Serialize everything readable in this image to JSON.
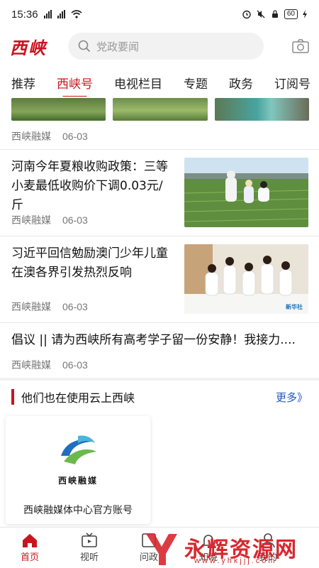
{
  "status_bar": {
    "time": "15:36",
    "battery": "60"
  },
  "header": {
    "logo": "西峡",
    "search_placeholder": "党政要闻"
  },
  "tabs": [
    "推荐",
    "西峡号",
    "电视栏目",
    "专题",
    "政务",
    "订阅号"
  ],
  "active_tab": "西峡号",
  "partial_item": {
    "source": "西峡融媒",
    "date": "06-03"
  },
  "news": [
    {
      "title_lines": [
        "河南今年夏粮收购政策：三等",
        "小麦最低收购价下调0.03元/",
        "斤"
      ],
      "source": "西峡融媒",
      "date": "06-03"
    },
    {
      "title_lines": [
        "习近平回信勉励澳门少年儿童",
        "在澳各界引发热烈反响"
      ],
      "source": "西峡融媒",
      "date": "06-03",
      "image_watermark": "新华社"
    },
    {
      "title_lines": [
        "倡议 || 请为西峡所有高考学子留一份安静！我接力...."
      ],
      "source": "西峡融媒",
      "date": "06-03"
    }
  ],
  "section": {
    "title": "他们也在使用云上西峡",
    "more": "更多》"
  },
  "account_card": {
    "org_logo_text": "西峡融媒",
    "name": "西峡融媒体中心官方账号"
  },
  "bottom_nav": [
    {
      "label": "首页",
      "icon": "home-icon"
    },
    {
      "label": "视听",
      "icon": "tv-icon"
    },
    {
      "label": "问政",
      "icon": "question-icon"
    },
    {
      "label": "知晓",
      "icon": "bell-icon"
    },
    {
      "label": "我的",
      "icon": "user-icon"
    }
  ],
  "watermark": {
    "text": "永辉资源网",
    "url": "www.yhkjjj.com"
  },
  "colors": {
    "accent": "#c9151e",
    "link": "#1f56c2"
  }
}
